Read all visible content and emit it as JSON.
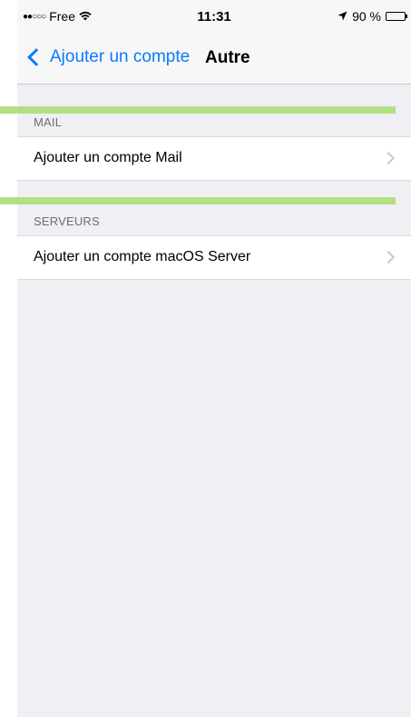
{
  "status_bar": {
    "carrier": "Free",
    "signal": "●●○○○",
    "time": "11:31",
    "battery_percent": "90 %",
    "battery_level": 0.9
  },
  "nav": {
    "back_label": "Ajouter un compte",
    "title": "Autre"
  },
  "sections": [
    {
      "header": "MAIL",
      "items": [
        {
          "label": "Ajouter un compte Mail"
        }
      ]
    },
    {
      "header": "SERVEURS",
      "items": [
        {
          "label": "Ajouter un compte macOS Server"
        }
      ]
    }
  ],
  "colors": {
    "accent": "#0a7aff",
    "highlight": "#b3e085",
    "background": "#efeff4"
  }
}
